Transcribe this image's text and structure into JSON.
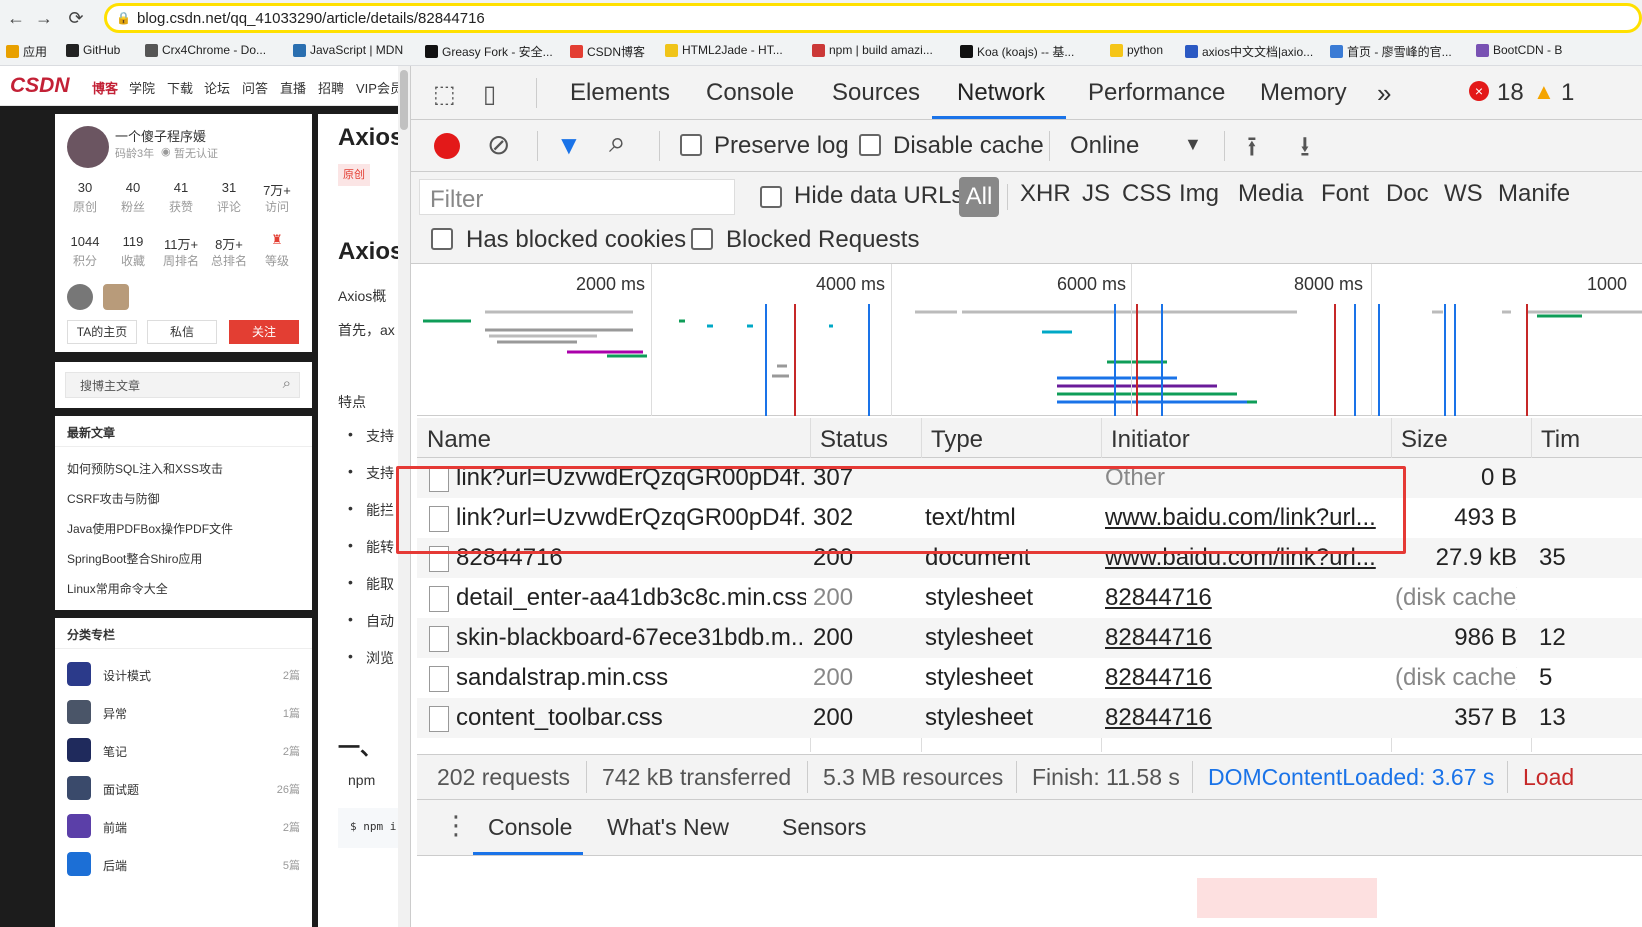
{
  "browser": {
    "url": "blog.csdn.net/qq_41033290/article/details/82844716",
    "bookmarks": [
      {
        "label": "应用",
        "color": "#e8a000"
      },
      {
        "label": "GitHub",
        "color": "#222222"
      },
      {
        "label": "Crx4Chrome - Do...",
        "color": "#555555"
      },
      {
        "label": "JavaScript | MDN",
        "color": "#2a6fb0"
      },
      {
        "label": "Greasy Fork - 安全...",
        "color": "#111111"
      },
      {
        "label": "CSDN博客",
        "color": "#e33e33"
      },
      {
        "label": "HTML2Jade - HT...",
        "color": "#f0c419"
      },
      {
        "label": "npm | build amazi...",
        "color": "#cb3837"
      },
      {
        "label": "Koa (koajs) -- 基...",
        "color": "#111111"
      },
      {
        "label": "python",
        "color": "#f5c518"
      },
      {
        "label": "axios中文文档|axio...",
        "color": "#2b59c3"
      },
      {
        "label": "首页 - 廖雪峰的官...",
        "color": "#3a7bd5"
      },
      {
        "label": "BootCDN - B",
        "color": "#7952b3"
      }
    ]
  },
  "csdn": {
    "logo": "CSDN",
    "nav": [
      "博客",
      "学院",
      "下载",
      "论坛",
      "问答",
      "直播",
      "招聘",
      "VIP会员"
    ],
    "profile": {
      "name": "一个傻子程序媛",
      "meta": "码龄3年",
      "verify": "暂无认证",
      "stats_row1": [
        {
          "num": "30",
          "label": "原创"
        },
        {
          "num": "40",
          "label": "粉丝"
        },
        {
          "num": "41",
          "label": "获赞"
        },
        {
          "num": "31",
          "label": "评论"
        },
        {
          "num": "7万+",
          "label": "访问"
        }
      ],
      "stats_row2": [
        {
          "num": "1044",
          "label": "积分"
        },
        {
          "num": "119",
          "label": "收藏"
        },
        {
          "num": "11万+",
          "label": "周排名"
        },
        {
          "num": "8万+",
          "label": "总排名"
        },
        {
          "num": "",
          "label": "等级"
        }
      ],
      "btn_home": "TA的主页",
      "btn_msg": "私信",
      "btn_follow": "关注"
    },
    "search_placeholder": "搜博主文章",
    "recent_title": "最新文章",
    "recent": [
      "如何预防SQL注入和XSS攻击",
      "CSRF攻击与防御",
      "Java使用PDFBox操作PDF文件",
      "SpringBoot整合Shiro应用",
      "Linux常用命令大全"
    ],
    "cat_title": "分类专栏",
    "categories": [
      {
        "name": "设计模式",
        "count": "2篇"
      },
      {
        "name": "异常",
        "count": "1篇"
      },
      {
        "name": "笔记",
        "count": "2篇"
      },
      {
        "name": "面试题",
        "count": "26篇"
      },
      {
        "name": "前端",
        "count": "2篇"
      },
      {
        "name": "后端",
        "count": "5篇"
      }
    ],
    "article": {
      "title1": "Axios",
      "badge": "原创",
      "title2": "Axios",
      "p1": "Axios概",
      "p2": "首先，ax",
      "features": "特点",
      "bullets": [
        "支持",
        "支持",
        "能拦",
        "能转",
        "能取",
        "自动",
        "浏览"
      ],
      "section": "一、",
      "npm": "npm",
      "code": "$ npm i"
    }
  },
  "devtools": {
    "tabs": [
      "Elements",
      "Console",
      "Sources",
      "Network",
      "Performance",
      "Memory"
    ],
    "more": "»",
    "errors": "18",
    "warnings": "1",
    "toolbar": {
      "preserve_log": "Preserve log",
      "disable_cache": "Disable cache",
      "throttle": "Online"
    },
    "filter": {
      "placeholder": "Filter",
      "hide_data_urls": "Hide data URLs",
      "all": "All",
      "types": [
        "XHR",
        "JS",
        "CSS",
        "Img",
        "Media",
        "Font",
        "Doc",
        "WS",
        "Manife"
      ],
      "blocked_cookies": "Has blocked cookies",
      "blocked_requests": "Blocked Requests"
    },
    "overview_labels": [
      "2000 ms",
      "4000 ms",
      "6000 ms",
      "8000 ms",
      "1000"
    ],
    "columns": [
      "Name",
      "Status",
      "Type",
      "Initiator",
      "Size",
      "Tim"
    ],
    "rows": [
      {
        "name": "link?url=UzvwdErQzqGR00pD4f...",
        "status": "307",
        "type": "",
        "initiator": "Other",
        "size": "0 B",
        "time": "",
        "status_grey": false,
        "init_link": false
      },
      {
        "name": "link?url=UzvwdErQzqGR00pD4f...",
        "status": "302",
        "type": "text/html",
        "initiator": "www.baidu.com/link?url...",
        "size": "493 B",
        "time": "",
        "status_grey": false,
        "init_link": true
      },
      {
        "name": "82844716",
        "status": "200",
        "type": "document",
        "initiator": "www.baidu.com/link?url...",
        "size": "27.9 kB",
        "time": "35",
        "status_grey": false,
        "init_link": true
      },
      {
        "name": "detail_enter-aa41db3c8c.min.css",
        "status": "200",
        "type": "stylesheet",
        "initiator": "82844716",
        "size": "(disk cache)",
        "time": "",
        "status_grey": true,
        "init_link": true
      },
      {
        "name": "skin-blackboard-67ece31bdb.m...",
        "status": "200",
        "type": "stylesheet",
        "initiator": "82844716",
        "size": "986 B",
        "time": "12",
        "status_grey": false,
        "init_link": true
      },
      {
        "name": "sandalstrap.min.css",
        "status": "200",
        "type": "stylesheet",
        "initiator": "82844716",
        "size": "(disk cache)",
        "time": "5",
        "status_grey": true,
        "init_link": true
      },
      {
        "name": "content_toolbar.css",
        "status": "200",
        "type": "stylesheet",
        "initiator": "82844716",
        "size": "357 B",
        "time": "13",
        "status_grey": false,
        "init_link": true
      }
    ],
    "status": {
      "requests": "202 requests",
      "transferred": "742 kB transferred",
      "resources": "5.3 MB resources",
      "finish": "Finish: 11.58 s",
      "dcl": "DOMContentLoaded: 3.67 s",
      "load": "Load"
    },
    "drawer_tabs": [
      "Console",
      "What's New",
      "Sensors"
    ],
    "colors": {
      "accent": "#1a73e8",
      "record": "#e31919",
      "highlight": "#e53935"
    }
  }
}
